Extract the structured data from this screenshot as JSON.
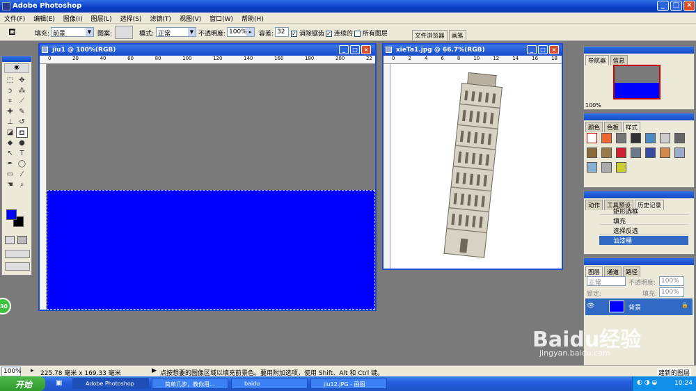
{
  "titlebar": {
    "title": "Adobe Photoshop"
  },
  "menubar": {
    "items": [
      "文件(F)",
      "编辑(E)",
      "图像(I)",
      "图层(L)",
      "选择(S)",
      "滤镜(T)",
      "视图(V)",
      "窗口(W)",
      "帮助(H)"
    ]
  },
  "options": {
    "fill_label": "填充:",
    "fill_value": "前景",
    "pattern_label": "图案:",
    "mode_label": "模式:",
    "mode_value": "正常",
    "opacity_label": "不透明度:",
    "opacity_value": "100%",
    "tolerance_label": "容差:",
    "tolerance_value": "32",
    "antialias_label": "消除锯齿",
    "contiguous_label": "连续的",
    "all_layers_label": "所有图层",
    "antialias_checked": true,
    "contiguous_checked": true,
    "all_layers_checked": false,
    "well_tabs": [
      "文件浏览器",
      "画笔"
    ]
  },
  "doc1": {
    "title": "jiu1 @ 100%(RGB)",
    "fill_color": "#0000ff",
    "canvas_color": "#7a7a7a",
    "ruler_marks": [
      "0",
      "20",
      "40",
      "60",
      "80",
      "100",
      "120",
      "140",
      "160",
      "180",
      "200",
      "22"
    ]
  },
  "doc2": {
    "title": "xieTa1.jpg @ 66.7%(RGB)",
    "ruler_marks": [
      "0",
      "2",
      "4",
      "6",
      "8",
      "10",
      "12",
      "14",
      "16",
      "18"
    ]
  },
  "toolbox": {
    "foreground": "#0000ff",
    "background": "#000000"
  },
  "navigator": {
    "tabs": [
      "导航器",
      "信息"
    ],
    "zoom": "100%"
  },
  "styles": {
    "tabs": [
      "颜色",
      "色板",
      "样式"
    ]
  },
  "history": {
    "tabs": [
      "动作",
      "工具预设",
      "历史记录"
    ],
    "items": [
      "矩形选框",
      "填充",
      "选择反选",
      "油漆桶"
    ]
  },
  "layers": {
    "tabs": [
      "图层",
      "通道",
      "路径"
    ],
    "mode": "正常",
    "opacity_label": "不透明度:",
    "opacity": "100%",
    "lock_label": "锁定:",
    "fill_label": "填充:",
    "fill": "100%",
    "layer_name": "背景",
    "footer": "建新的图层"
  },
  "status": {
    "zoom": "100%",
    "doc_info": "225.78 毫米 x 169.33 毫米",
    "hint": "点按想要的图像区域以填充前景色。要用附加选项，使用 Shift、Alt 和 Ctrl 键。"
  },
  "taskbar": {
    "start": "开始",
    "items": [
      "Adobe Photoshop",
      "简单几步，教你用...",
      "baidu",
      "jiu12.JPG - 画图"
    ],
    "clock": "10:24"
  },
  "watermark": {
    "brand": "Baidu经验",
    "url": "jingyan.baidu.com"
  },
  "badge": {
    "value": "30"
  }
}
